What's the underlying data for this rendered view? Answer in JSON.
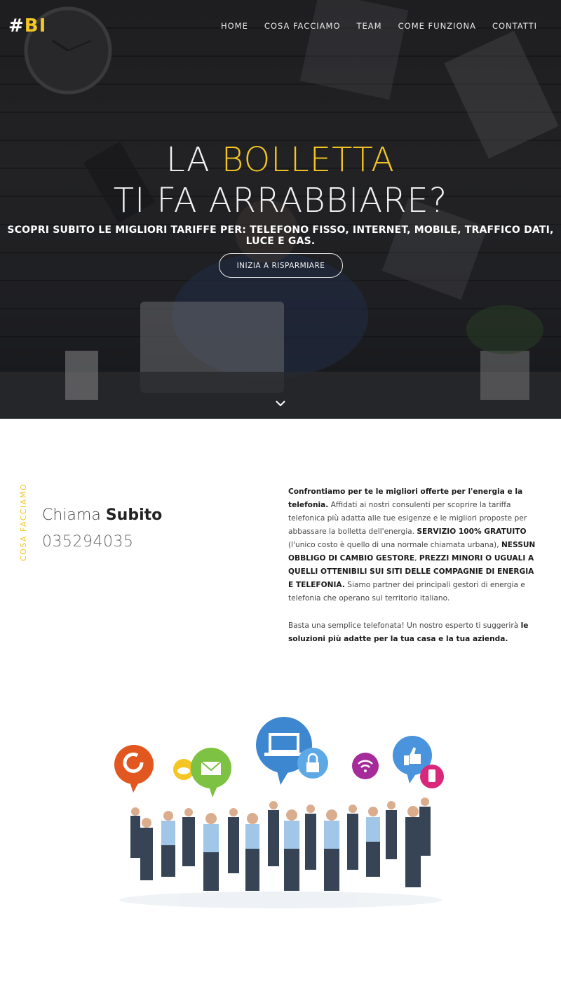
{
  "header": {
    "logo": {
      "hash": "#",
      "letters": "BI"
    },
    "nav": [
      "HOME",
      "COSA FACCIAMO",
      "TEAM",
      "COME FUNZIONA",
      "CONTATTI"
    ]
  },
  "hero": {
    "line1_prefix": "LA",
    "line1_highlight": "BOLLETTA",
    "line2": "TI FA ARRABBIARE?",
    "subtitle": "SCOPRI SUBITO LE MIGLIORI TARIFFE PER: TELEFONO FISSO, INTERNET, MOBILE, TRAFFICO DATI, LUCE E GAS.",
    "cta_label": "INIZIA A RISPARMIARE",
    "scroll_icon": "chevron-down-icon"
  },
  "section": {
    "side_label": "COSA  FACCIAMO",
    "call_prefix": "Chiama",
    "call_strong": "Subito",
    "phone": "035294035",
    "p1_bold1": "Confrontiamo per te le migliori offerte per l'energia e la telefonia.",
    "p1_text1": " Affidati ai nostri consulenti per scoprire la tariffa telefonica più adatta alle tue esigenze e le migliori proposte per abbassare la bolletta dell'energia. ",
    "p1_bold2": "SERVIZIO 100% GRATUITO",
    "p1_text2": " (l'unico costo è quello di una normale chiamata urbana), ",
    "p1_bold3": "NESSUN OBBLIGO DI CAMBIO GESTORE",
    "p1_text3": ", ",
    "p1_bold4": "PREZZI MINORI O UGUALI A QUELLI OTTENIBILI SUI SITI DELLE COMPAGNIE DI ENERGIA E TELEFONIA.",
    "p1_text4": " Siamo partner dei principali gestori di energia e telefonia che operano sul territorio italiano.",
    "p2_text": "Basta una semplice telefonata! Un nostro esperto ti suggerirà ",
    "p2_bold": "le soluzioni più adatte per la tua casa e la tua azienda."
  },
  "colors": {
    "accent": "#f3c623",
    "hero_bg": "#2c2c2f"
  }
}
